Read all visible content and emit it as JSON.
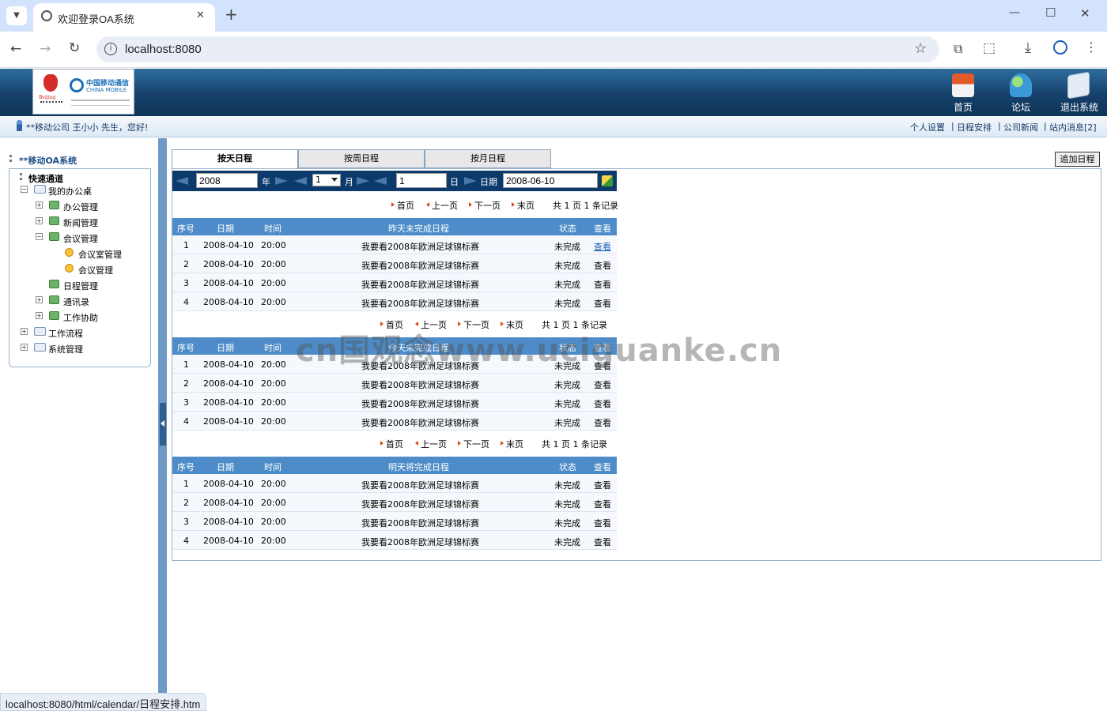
{
  "browser": {
    "tab_title": "欢迎登录OA系统",
    "url": "localhost:8080",
    "status_url": "localhost:8080/html/calendar/日程安排.htm",
    "new_tab": "+",
    "minimize": "—",
    "maximize": "☐",
    "close": "✕"
  },
  "header": {
    "logo_text": "中国移动通信",
    "logo_text_en": "CHINA MOBILE",
    "nav": [
      {
        "label": "首页",
        "icon": "home-icon"
      },
      {
        "label": "论坛",
        "icon": "users-icon"
      },
      {
        "label": "退出系统",
        "icon": "exit-icon"
      }
    ],
    "greeting": "**移动公司 王小小 先生，您好!",
    "links": [
      "个人设置",
      "日程安排",
      "公司新闻",
      "站内消息[2]"
    ],
    "separator": "|"
  },
  "sidebar": {
    "title": "**移动OA系统",
    "quick": "快速通道",
    "tree": [
      {
        "label": "我的办公桌",
        "level": 1,
        "icon": "folder-icon",
        "toggle": "−"
      },
      {
        "label": "办公管理",
        "level": 2,
        "icon": "module-icon",
        "toggle": "+"
      },
      {
        "label": "新闻管理",
        "level": 2,
        "icon": "module-icon",
        "toggle": "+"
      },
      {
        "label": "会议管理",
        "level": 2,
        "icon": "module-icon",
        "toggle": "−"
      },
      {
        "label": "会议室管理",
        "level": 3,
        "icon": "gear-icon",
        "toggle": ""
      },
      {
        "label": "会议管理",
        "level": 3,
        "icon": "gear-icon",
        "toggle": ""
      },
      {
        "label": "日程管理",
        "level": 2,
        "icon": "module-icon",
        "toggle": ""
      },
      {
        "label": "通讯录",
        "level": 2,
        "icon": "module-icon",
        "toggle": "+"
      },
      {
        "label": "工作协助",
        "level": 2,
        "icon": "module-icon",
        "toggle": "+"
      },
      {
        "label": "工作流程",
        "level": 1,
        "icon": "folder-icon",
        "toggle": "+"
      },
      {
        "label": "系统管理",
        "level": 1,
        "icon": "folder-icon",
        "toggle": "+"
      }
    ]
  },
  "tabs": [
    "按天日程",
    "按周日程",
    "按月日程"
  ],
  "add_button": "追加日程",
  "date_bar": {
    "year": "2008",
    "year_label": "年",
    "month": "1",
    "month_label": "月",
    "day": "1",
    "day_label": "日",
    "date_label": "日期",
    "date": "2008-06-10"
  },
  "pager": {
    "first": "首页",
    "prev": "上一页",
    "next": "下一页",
    "last": "末页",
    "summary": "共 1 页 1 条记录"
  },
  "columns": {
    "seq": "序号",
    "date": "日期",
    "time": "时间",
    "status": "状态",
    "view": "查看"
  },
  "tables": [
    {
      "title": "昨天未完成日程",
      "rows": [
        {
          "seq": "1",
          "date": "2008-04-10",
          "time": "20:00",
          "content": "我要看2008年欧洲足球锦标赛",
          "status": "未完成",
          "view": "查看"
        },
        {
          "seq": "2",
          "date": "2008-04-10",
          "time": "20:00",
          "content": "我要看2008年欧洲足球锦标赛",
          "status": "未完成",
          "view": "查看"
        },
        {
          "seq": "3",
          "date": "2008-04-10",
          "time": "20:00",
          "content": "我要看2008年欧洲足球锦标赛",
          "status": "未完成",
          "view": "查看"
        },
        {
          "seq": "4",
          "date": "2008-04-10",
          "time": "20:00",
          "content": "我要看2008年欧洲足球锦标赛",
          "status": "未完成",
          "view": "查看"
        }
      ]
    },
    {
      "title": "今天未完成日程",
      "rows": [
        {
          "seq": "1",
          "date": "2008-04-10",
          "time": "20:00",
          "content": "我要看2008年欧洲足球锦标赛",
          "status": "未完成",
          "view": "查看"
        },
        {
          "seq": "2",
          "date": "2008-04-10",
          "time": "20:00",
          "content": "我要看2008年欧洲足球锦标赛",
          "status": "未完成",
          "view": "查看"
        },
        {
          "seq": "3",
          "date": "2008-04-10",
          "time": "20:00",
          "content": "我要看2008年欧洲足球锦标赛",
          "status": "未完成",
          "view": "查看"
        },
        {
          "seq": "4",
          "date": "2008-04-10",
          "time": "20:00",
          "content": "我要看2008年欧洲足球锦标赛",
          "status": "未完成",
          "view": "查看"
        }
      ]
    },
    {
      "title": "明天将完成日程",
      "rows": [
        {
          "seq": "1",
          "date": "2008-04-10",
          "time": "20:00",
          "content": "我要看2008年欧洲足球锦标赛",
          "status": "未完成",
          "view": "查看"
        },
        {
          "seq": "2",
          "date": "2008-04-10",
          "time": "20:00",
          "content": "我要看2008年欧洲足球锦标赛",
          "status": "未完成",
          "view": "查看"
        },
        {
          "seq": "3",
          "date": "2008-04-10",
          "time": "20:00",
          "content": "我要看2008年欧洲足球锦标赛",
          "status": "未完成",
          "view": "查看"
        },
        {
          "seq": "4",
          "date": "2008-04-10",
          "time": "20:00",
          "content": "我要看2008年欧洲足球锦标赛",
          "status": "未完成",
          "view": "查看"
        }
      ]
    }
  ],
  "watermark": "cn国观念www.uciguanke.cn",
  "colors": {
    "header_blue": "#16406a",
    "table_header": "#4d8cc8",
    "link_blue": "#1a5fb4",
    "pager_arrow": "#d94a12"
  }
}
